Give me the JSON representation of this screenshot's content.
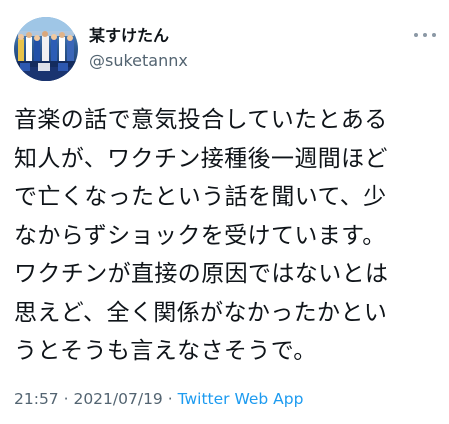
{
  "author": {
    "name": "某すけたん",
    "handle": "@suketannx"
  },
  "tweet": {
    "lines": [
      "音楽の話で意気投合していたとある",
      "知人が、ワクチン接種後一週間ほど",
      "で亡くなったという話を聞いて、少",
      "なからずショックを受けています。",
      "ワクチンが直接の原因ではないとは",
      "思えど、全く関係がなかったかとい",
      "うとそうも言えなさそうで。"
    ]
  },
  "meta": {
    "time": "21:57",
    "separator_1": " · ",
    "date": "2021/07/19",
    "separator_2": " · ",
    "source": "Twitter Web App"
  },
  "colors": {
    "text": "#0f1419",
    "secondary": "#536471",
    "link": "#1d9bf0"
  },
  "icons": {
    "more": "more-horizontal-icon"
  }
}
